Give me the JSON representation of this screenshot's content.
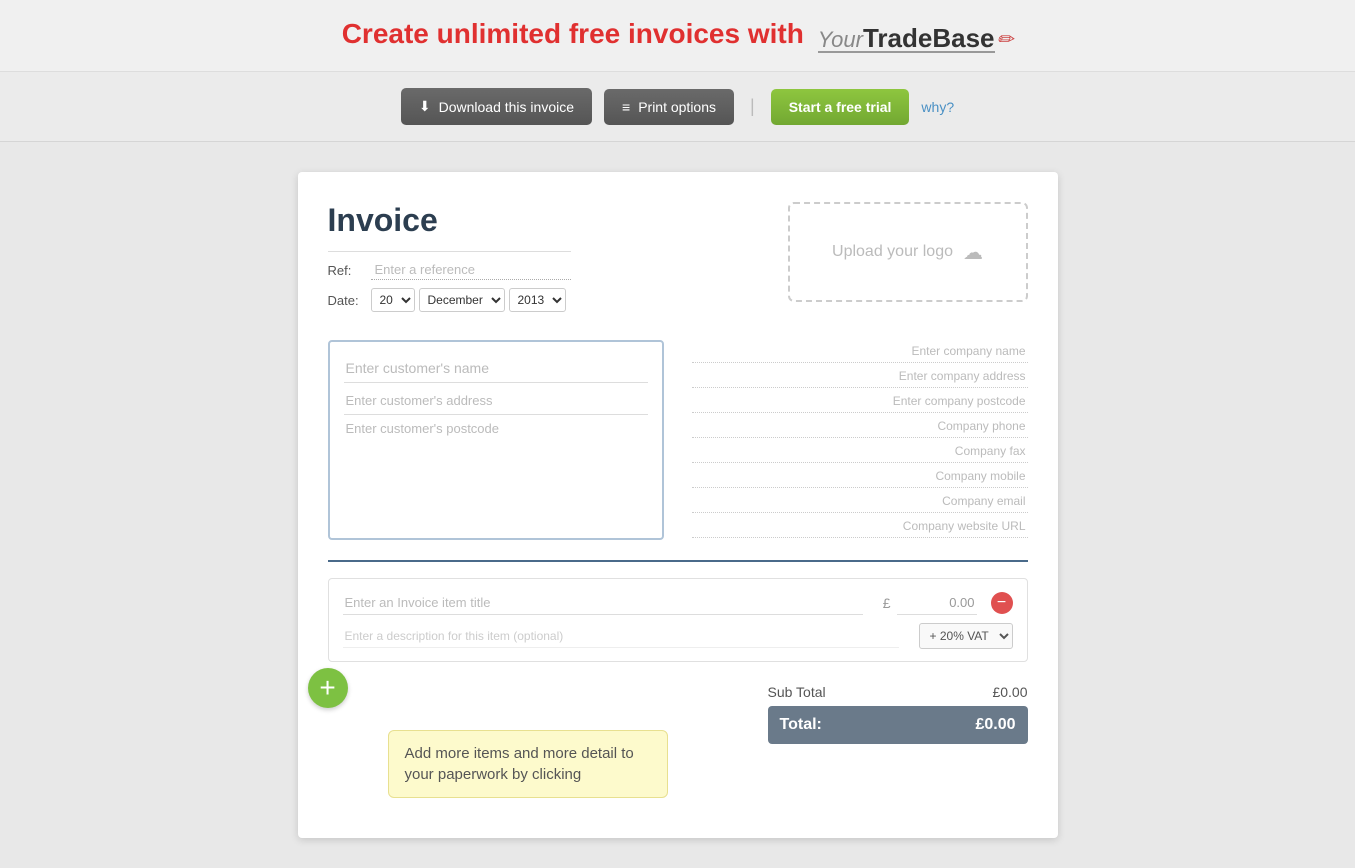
{
  "header": {
    "tagline": "Create unlimited free invoices with",
    "brand": {
      "your": "Your",
      "trade": "Trade",
      "base": "Base"
    }
  },
  "toolbar": {
    "download_label": "Download this invoice",
    "print_label": "Print options",
    "trial_label": "Start a free trial",
    "why_label": "why?",
    "divider": "|"
  },
  "invoice": {
    "title": "Invoice",
    "ref_label": "Ref:",
    "ref_placeholder": "Enter a reference",
    "date_label": "Date:",
    "date_day": "20",
    "date_month": "December",
    "date_year": "2013",
    "logo_upload_text": "Upload your logo"
  },
  "customer": {
    "name_placeholder": "Enter customer's name",
    "address_placeholder": "Enter customer's address",
    "postcode_placeholder": "Enter customer's postcode"
  },
  "company": {
    "name_placeholder": "Enter company name",
    "address_placeholder": "Enter company address",
    "postcode_placeholder": "Enter company postcode",
    "phone_placeholder": "Company phone",
    "fax_placeholder": "Company fax",
    "mobile_placeholder": "Company mobile",
    "email_placeholder": "Company email",
    "website_placeholder": "Company website URL"
  },
  "item": {
    "title_placeholder": "Enter an Invoice item title",
    "desc_placeholder": "Enter a description for this item (optional)",
    "amount": "0.00",
    "currency_symbol": "£",
    "vat_label": "+ 20% VAT"
  },
  "totals": {
    "subtotal_label": "Sub Total",
    "subtotal_value": "£0.00",
    "total_label": "Total:",
    "total_value": "£0.00"
  },
  "hint": {
    "text": "Add more items and more detail to your paperwork by clicking"
  },
  "icons": {
    "download": "⬇",
    "print": "≡",
    "cloud": "☁",
    "plus": "+",
    "minus": "−",
    "remove": "−"
  }
}
